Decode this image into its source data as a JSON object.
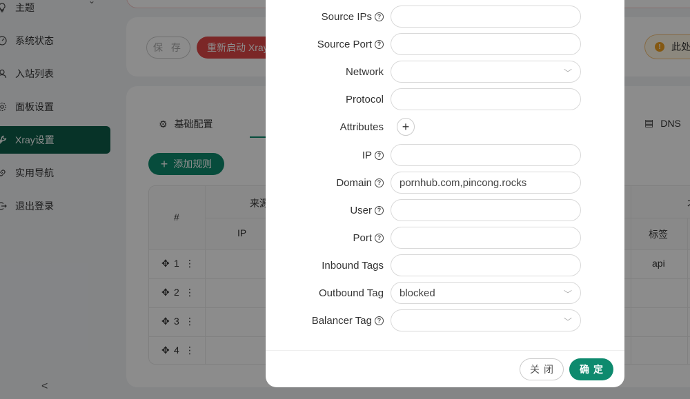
{
  "sidebar": {
    "items": [
      {
        "label": "主题",
        "icon": "bulb-icon"
      },
      {
        "label": "系统状态",
        "icon": "dashboard-icon"
      },
      {
        "label": "入站列表",
        "icon": "user-icon"
      },
      {
        "label": "面板设置",
        "icon": "gear-icon"
      },
      {
        "label": "Xray设置",
        "icon": "wrench-icon"
      },
      {
        "label": "实用导航",
        "icon": "link-icon"
      },
      {
        "label": "退出登录",
        "icon": "logout-icon"
      }
    ],
    "collapse": "<"
  },
  "toolbar": {
    "save_label": "保 存",
    "restart_label": "重新启动 Xray",
    "warning": "此处"
  },
  "tabs": {
    "basic": "基础配置",
    "dns": "DNS"
  },
  "rules": {
    "add_label": "添加规则",
    "headers": {
      "num": "#",
      "source": "来源",
      "ip": "IP",
      "tag": "标签",
      "col_right": "才"
    },
    "rows": [
      {
        "num": "1",
        "tag": "api"
      },
      {
        "num": "2",
        "tag": ""
      },
      {
        "num": "3",
        "tag": ""
      },
      {
        "num": "4",
        "tag": ""
      }
    ]
  },
  "form": {
    "source_ips": {
      "label": "Source IPs",
      "value": ""
    },
    "source_port": {
      "label": "Source Port",
      "value": ""
    },
    "network": {
      "label": "Network",
      "value": ""
    },
    "protocol": {
      "label": "Protocol",
      "value": ""
    },
    "attributes": {
      "label": "Attributes"
    },
    "ip": {
      "label": "IP",
      "value": ""
    },
    "domain": {
      "label": "Domain",
      "value": "pornhub.com,pincong.rocks"
    },
    "user": {
      "label": "User",
      "value": ""
    },
    "port": {
      "label": "Port",
      "value": ""
    },
    "inbound_tags": {
      "label": "Inbound Tags",
      "value": ""
    },
    "outbound_tag": {
      "label": "Outbound Tag",
      "value": "blocked"
    },
    "balancer_tag": {
      "label": "Balancer Tag",
      "value": ""
    }
  },
  "modal": {
    "close_label": "关闭",
    "ok_label": "确定"
  },
  "colors": {
    "primary": "#0e8a6e",
    "sidebar_active": "#0e5d4a",
    "danger": "#e04848",
    "warning": "#f0a020"
  }
}
